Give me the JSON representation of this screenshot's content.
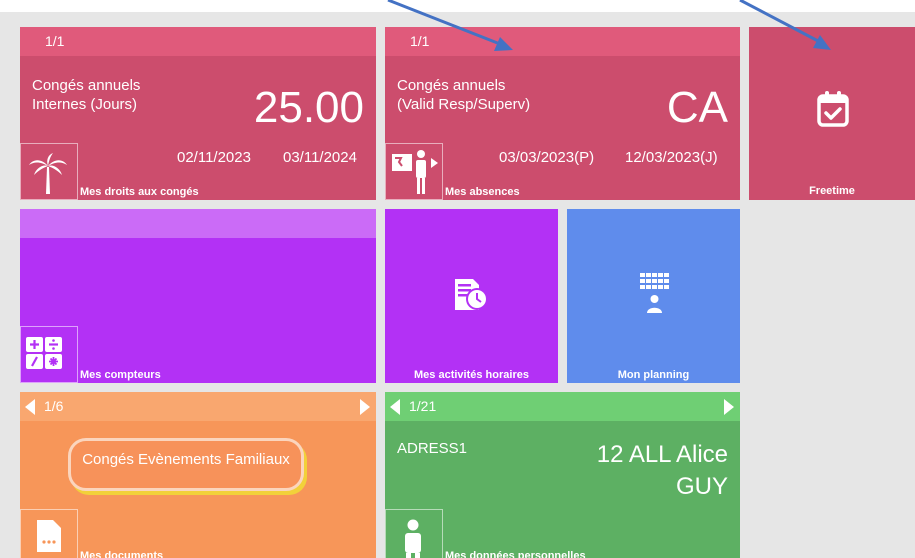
{
  "tiles": {
    "droits": {
      "pager": "1/1",
      "line1": "Congés annuels",
      "line2": "Internes (Jours)",
      "value": "25.00",
      "date1": "02/11/2023",
      "date2": "03/11/2024",
      "name": "Mes droits aux congés"
    },
    "absences": {
      "pager": "1/1",
      "line1": "Congés annuels",
      "line2": "(Valid Resp/Superv)",
      "value": "CA",
      "date1": "03/03/2023(P)",
      "date2": "12/03/2023(J)",
      "name": "Mes absences"
    },
    "freetime": {
      "name": "Freetime"
    },
    "compteurs": {
      "name": "Mes compteurs"
    },
    "activites": {
      "name": "Mes activités horaires"
    },
    "planning": {
      "name": "Mon planning"
    },
    "documents": {
      "pager": "1/6",
      "button": "Congés Evènements Familiaux",
      "name": "Mes documents"
    },
    "personnel": {
      "pager": "1/21",
      "label": "ADRESS1",
      "value_line1": "12 ALL Alice",
      "value_line2": "GUY",
      "name": "Mes données personnelles"
    }
  },
  "colors": {
    "pink": "#cc4d6d",
    "pink_bar": "#e05a7b",
    "purple": "#b331f5",
    "purple_bar": "#cb6bf7",
    "blue": "#5f8cec",
    "orange": "#f79659",
    "green": "#5db063",
    "green_bar": "#6fcf74",
    "annotation": "#4472c4"
  }
}
